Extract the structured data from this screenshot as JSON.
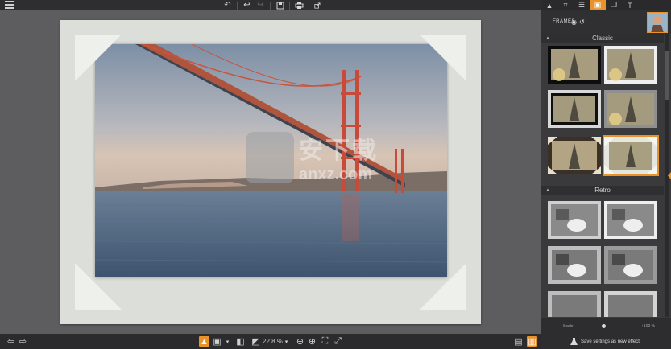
{
  "toolbar": {
    "icons": [
      "menu-icon",
      "undo-icon",
      "undo-step-icon",
      "redo-icon",
      "save-icon",
      "print-icon",
      "share-icon"
    ]
  },
  "panel": {
    "tabs": [
      "adjust-icon",
      "crop-icon",
      "sliders-icon",
      "frames-icon",
      "layers-icon",
      "text-icon"
    ],
    "active_tab": "frames-icon",
    "header_title": "FRAMES",
    "sections": [
      {
        "label": "Classic"
      },
      {
        "label": "Retro"
      }
    ],
    "scale_label": "Scale",
    "scale_value": "+100 %",
    "scale_level": 0.45,
    "save_label": "Save settings as new effect"
  },
  "statusbar": {
    "zoom": "22.8 %"
  },
  "watermark": {
    "cn": "安下载",
    "en": "anxz.com"
  },
  "colors": {
    "accent": "#e8922a",
    "panel_bg": "#3a3a3c",
    "canvas_bg": "#5d5d5f"
  }
}
